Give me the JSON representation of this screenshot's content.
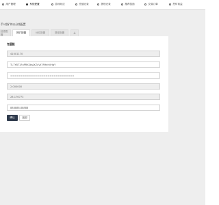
{
  "nav": {
    "items": [
      {
        "label": "用户管理"
      },
      {
        "label": "系统配置"
      },
      {
        "label": "游戏玩法"
      },
      {
        "label": "充值记录"
      },
      {
        "label": "提现记录"
      },
      {
        "label": "推荐奖励"
      },
      {
        "label": "交易订单"
      },
      {
        "label": "挖矿收益"
      }
    ],
    "active_index": 1
  },
  "page": {
    "title": "币1挖矿的公分钱配置"
  },
  "tabs": [
    {
      "label": "信息配置"
    },
    {
      "label": "挖矿配置"
    },
    {
      "label": "分红配置"
    },
    {
      "label": "提现配置"
    },
    {
      "label": "+"
    }
  ],
  "form": {
    "section_label": "充值链",
    "fields": [
      {
        "value": "41001170",
        "readonly": true
      },
      {
        "value": "TL7Y8T1FuPRKSbsJXZuVt7R9ehVHgY",
        "readonly": false
      },
      {
        "value": "===============================",
        "readonly": false
      },
      {
        "value": "2.000000",
        "readonly": true
      },
      {
        "value": "28.176773",
        "readonly": true
      },
      {
        "value": "888888.88888",
        "readonly": false
      }
    ]
  },
  "buttons": {
    "save": "确认",
    "back": "返回"
  },
  "colors": {
    "nav_bg": "#ffffff",
    "content_bg": "#eeeeee",
    "primary_button": "#2f3a4c"
  }
}
